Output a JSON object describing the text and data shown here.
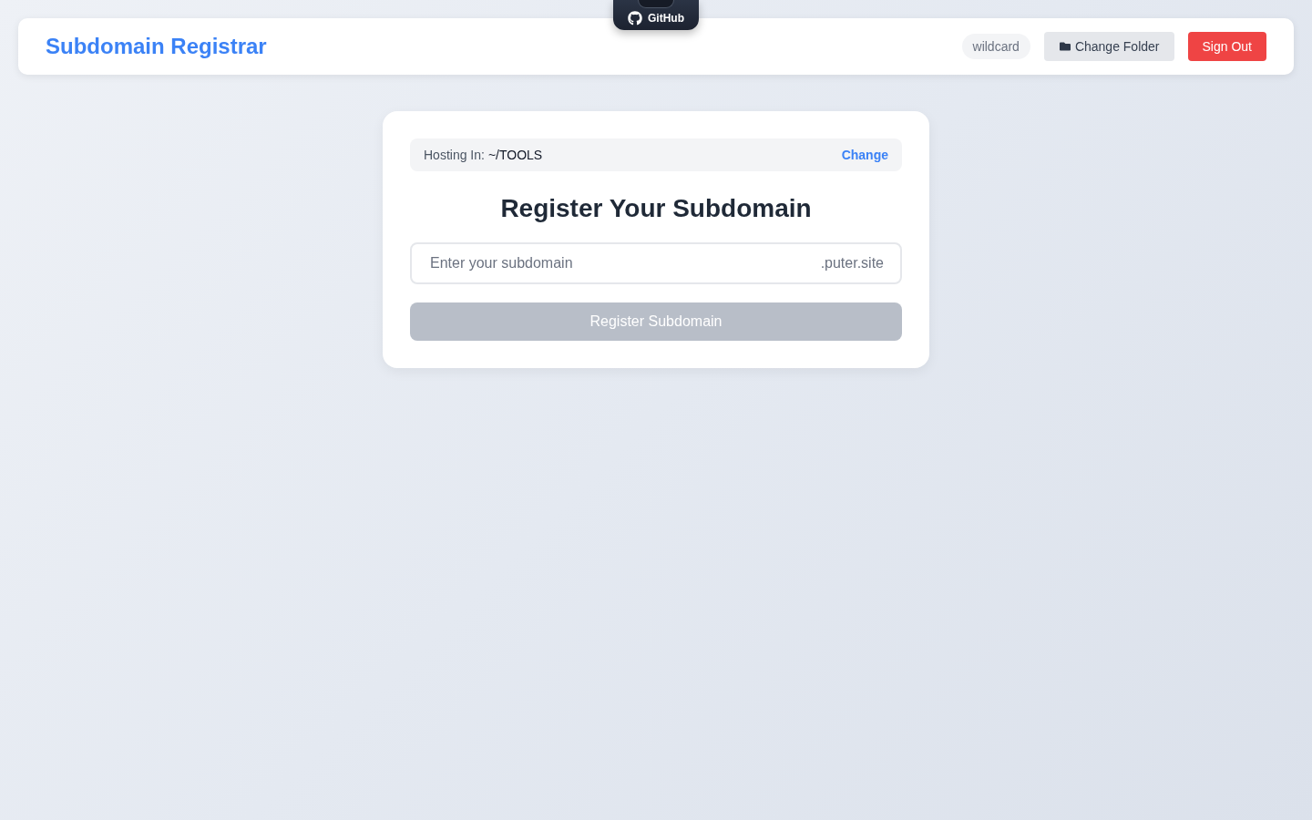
{
  "github_badge": {
    "label": "GitHub"
  },
  "header": {
    "title": "Subdomain Registrar",
    "badge": "wildcard",
    "buttons": [
      {
        "label": "Change Folder",
        "kind": "secondary"
      },
      {
        "label": "Sign Out",
        "kind": "danger"
      }
    ]
  },
  "hosting": {
    "label": "Hosting In:",
    "path": "~/TOOLS",
    "action": "Change"
  },
  "heading": "Register Your Subdomain",
  "subdomain_field": {
    "placeholder": "Enter your subdomain",
    "suffix": ".puter.site"
  },
  "submit": {
    "label": "Register Subdomain",
    "disabled": true
  }
}
